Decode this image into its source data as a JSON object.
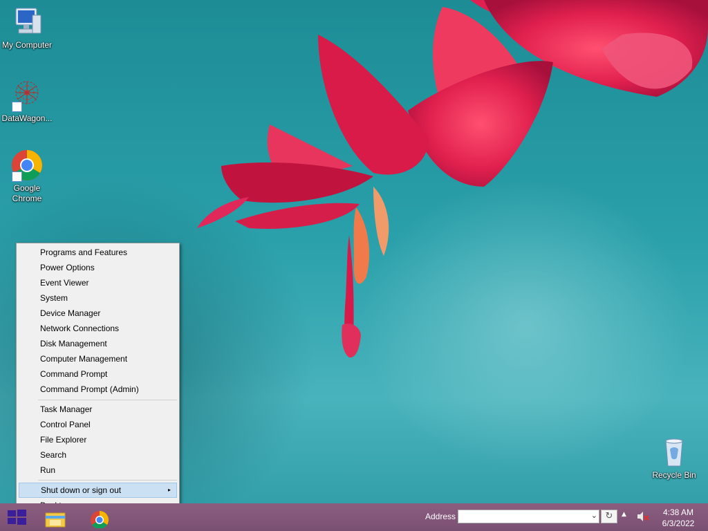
{
  "desktop": {
    "icons": [
      {
        "label": "My Computer",
        "icon": "computer-icon"
      },
      {
        "label": "DataWagon...",
        "icon": "datawagon-icon"
      },
      {
        "label": "Google\nChrome",
        "icon": "chrome-icon"
      },
      {
        "label": "Recycle Bin",
        "icon": "recycle-bin-icon"
      }
    ]
  },
  "menu": {
    "items": [
      {
        "label": "Programs and Features"
      },
      {
        "label": "Power Options"
      },
      {
        "label": "Event Viewer"
      },
      {
        "label": "System"
      },
      {
        "label": "Device Manager"
      },
      {
        "label": "Network Connections"
      },
      {
        "label": "Disk Management"
      },
      {
        "label": "Computer Management"
      },
      {
        "label": "Command Prompt"
      },
      {
        "label": "Command Prompt (Admin)"
      },
      {
        "label": "Task Manager"
      },
      {
        "label": "Control Panel"
      },
      {
        "label": "File Explorer"
      },
      {
        "label": "Search"
      },
      {
        "label": "Run"
      },
      {
        "label": "Shut down or sign out",
        "submenu_arrow": "▸",
        "state": "hovered"
      },
      {
        "label": "Desktop"
      }
    ]
  },
  "taskbar": {
    "address_label": "Address",
    "address_value": "",
    "dropdown_glyph": "⌄",
    "refresh_glyph": "↻",
    "tray_arrow": "▲",
    "time": "4:38 AM",
    "date": "6/3/2022",
    "apps": [
      {
        "icon": "file-explorer-icon"
      },
      {
        "icon": "chrome-icon"
      }
    ]
  },
  "colors": {
    "accent": "#4b1d8c",
    "taskbar": "#7f5477",
    "menu_hover": "#cce0f3"
  }
}
